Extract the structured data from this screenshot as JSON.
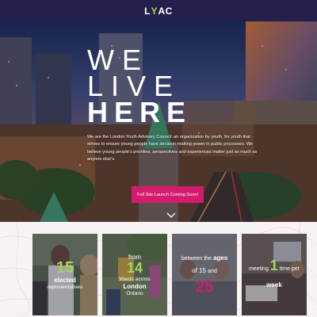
{
  "navbar": {
    "logo": {
      "l": "L",
      "y": "Y",
      "ac": "AC"
    }
  },
  "hero": {
    "title_line1": "WE",
    "title_line2": "LIVE",
    "title_line3": "HERE",
    "description": "We are the London Youth Advisory Council: an organization by youth, for youth that strives to ensure young people have decision-making power in public processes. We believe young people's priorities, perspectives and experiences matter just as much as anyone else's.",
    "cta_label": "Full Site Launch Coming Soon!"
  },
  "cards": [
    {
      "number": "15",
      "line1": "elected",
      "line2": "representatives"
    },
    {
      "pre": "from",
      "number": "14",
      "line1": "Wards across",
      "line2": "London",
      "line3": "Ontario"
    },
    {
      "pre": "between the",
      "pre_bold": "ages",
      "number_a": "of 15",
      "conj": "and",
      "number_b": "25"
    },
    {
      "pre": "meeting",
      "number": "1",
      "post": "time per",
      "line1": "week"
    }
  ],
  "colors": {
    "navy": "#23204b",
    "accent_green": "#a3d65a",
    "accent_pink": "#d41c6e"
  }
}
